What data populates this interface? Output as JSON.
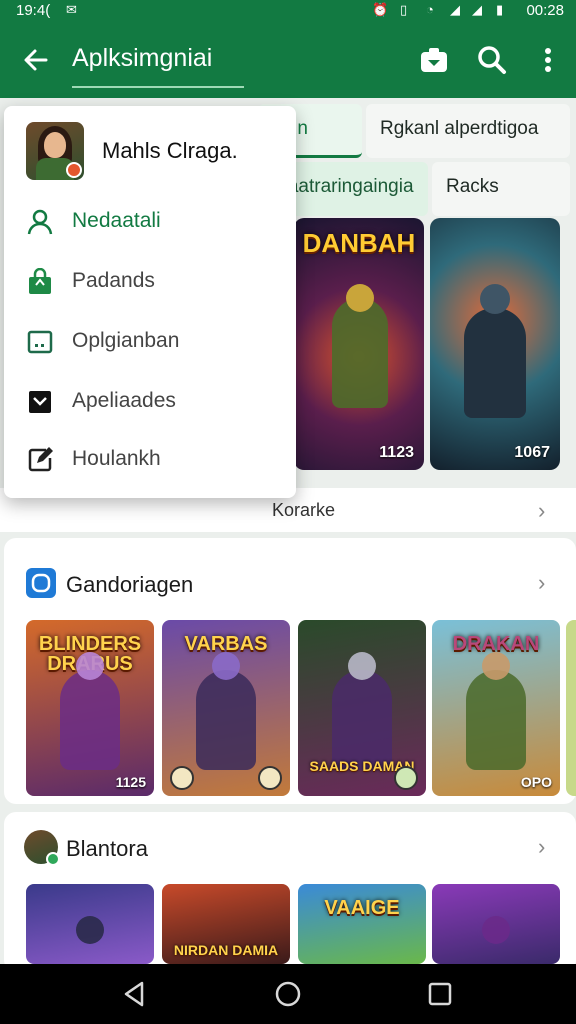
{
  "status_bar": {
    "time": "19:4(",
    "clock": "00:28"
  },
  "app_bar": {
    "title": "Aplksimgniai"
  },
  "tabs": [
    {
      "label": "niun"
    },
    {
      "label": "Rgkanl alperdtigoa"
    },
    {
      "label": "maatraringaingia"
    },
    {
      "label": "Racks"
    }
  ],
  "featured": [
    {
      "title": "DANBAH",
      "badge": "1123"
    },
    {
      "title": "",
      "badge": "1067"
    }
  ],
  "korarke": {
    "label": "Korarke"
  },
  "sections": [
    {
      "title": "Gandoriagen",
      "games": [
        {
          "title": "BLINDERS DRARUS",
          "number": "1125",
          "subtitle": ""
        },
        {
          "title": "VARBAS",
          "number": "",
          "subtitle": ""
        },
        {
          "title": "",
          "number": "",
          "subtitle": "SAADS DAMAN"
        },
        {
          "title": "DRAKAN",
          "number": "OPO",
          "subtitle": ""
        }
      ]
    },
    {
      "title": "Blantora",
      "games": [
        {
          "title": "",
          "number": "",
          "subtitle": ""
        },
        {
          "title": "",
          "number": "",
          "subtitle": "NIRDAN DAMIA"
        },
        {
          "title": "VAAIGE",
          "number": "",
          "subtitle": ""
        },
        {
          "title": "",
          "number": "",
          "subtitle": ""
        }
      ]
    }
  ],
  "drawer": {
    "name": "Mahls Clraga.",
    "items": [
      {
        "label": "Nedaatali"
      },
      {
        "label": "Padands"
      },
      {
        "label": "Oplgianban"
      },
      {
        "label": "Apeliaades"
      },
      {
        "label": "Houlankh"
      }
    ]
  },
  "colors": {
    "primary": "#127a42",
    "accent_light": "#dff2e5"
  }
}
